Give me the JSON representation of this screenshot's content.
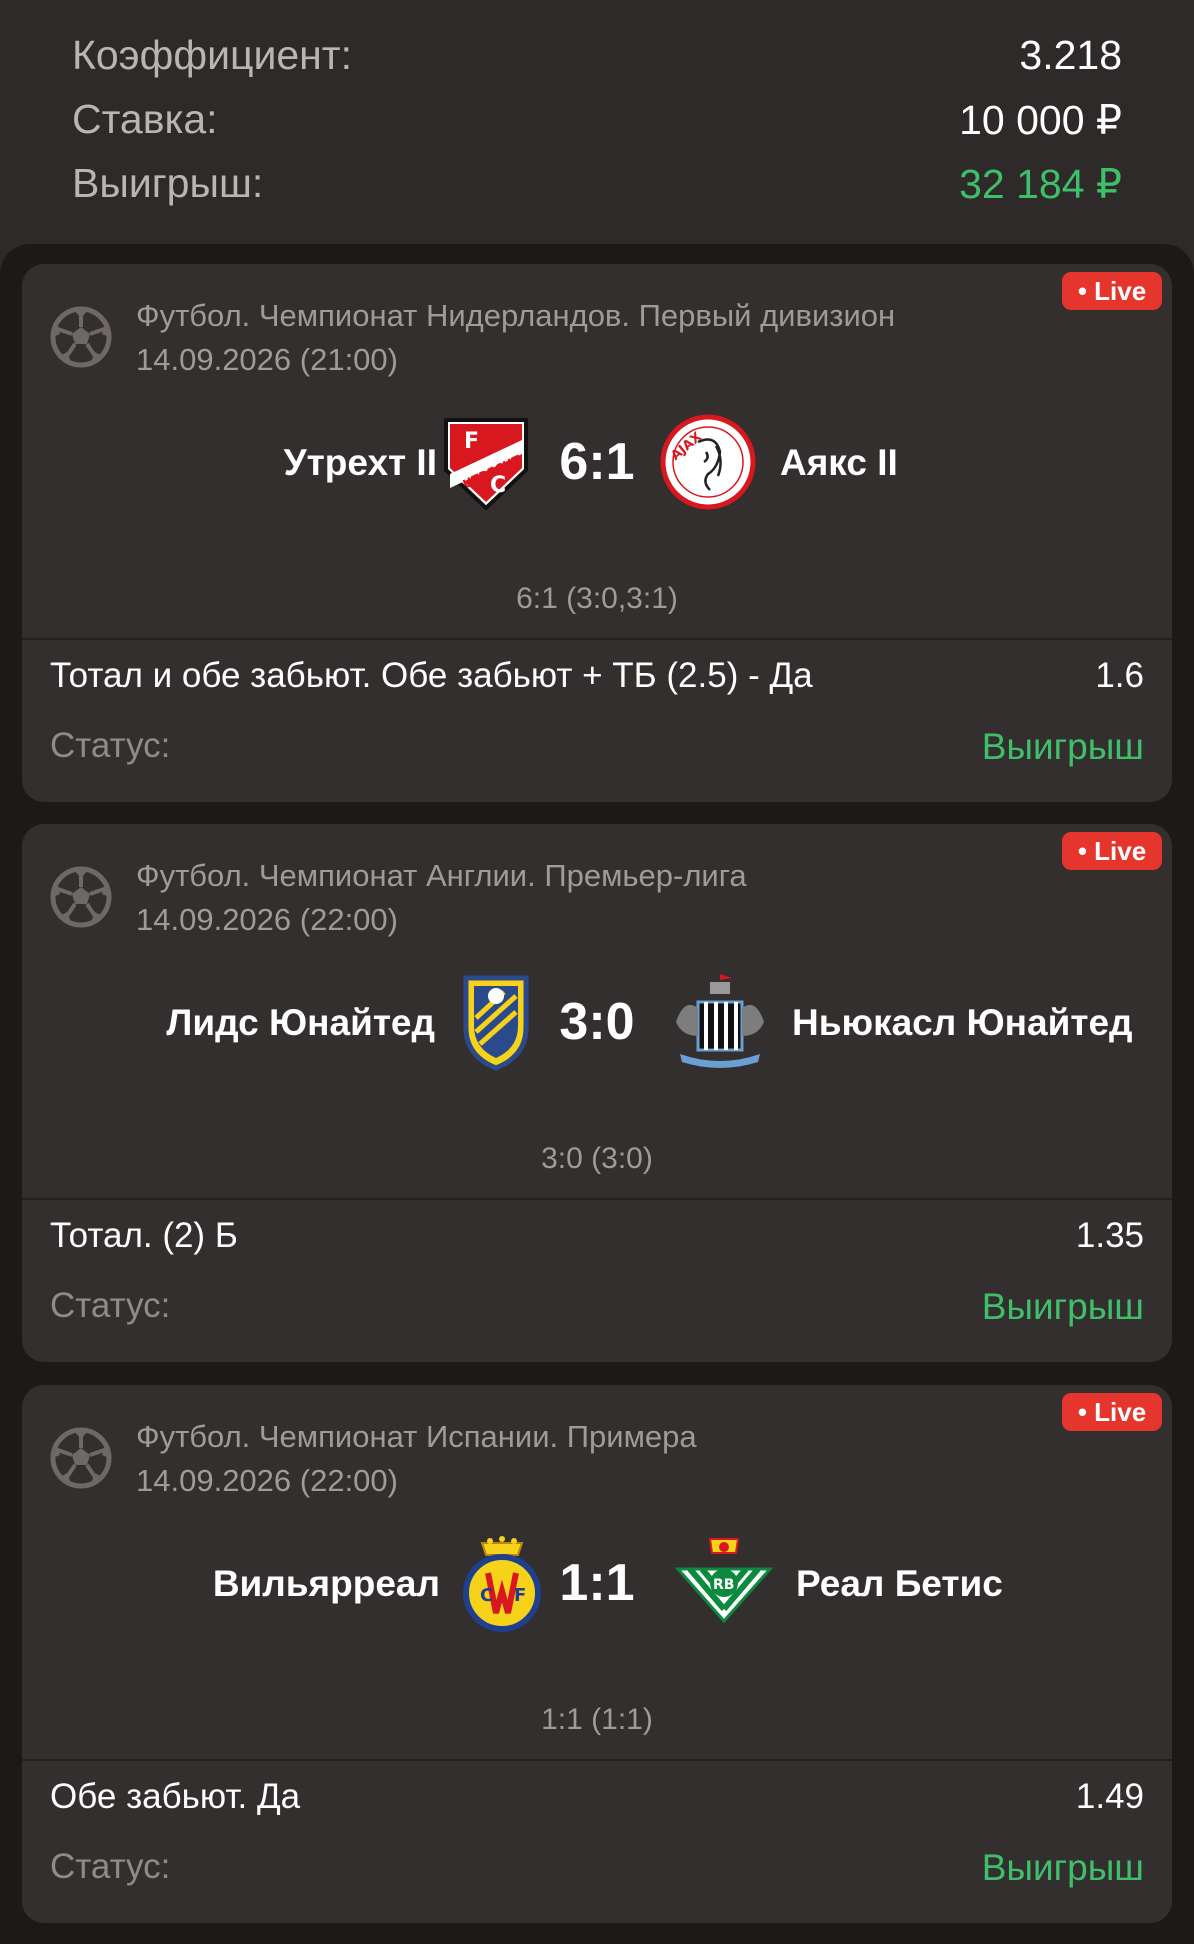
{
  "summary": {
    "coef_label": "Коэффициент:",
    "coef_value": "3.218",
    "stake_label": "Ставка:",
    "stake_value": "10 000 ₽",
    "win_label": "Выигрыш:",
    "win_value": "32 184 ₽"
  },
  "colors": {
    "win_green": "#3fbf6a",
    "live_red": "#e5352d",
    "card_bg": "#332f2e",
    "page_bg": "#1c1918"
  },
  "bets": [
    {
      "live": "• Live",
      "sport_icon": "soccer-ball-icon",
      "league": "Футбол. Чемпионат Нидерландов. Первый дивизион",
      "date": "14.09.2026 (21:00)",
      "home": "Утрехт II",
      "home_crest": "utrecht-crest-icon",
      "score": "6:1",
      "away": "Аякс II",
      "away_crest": "ajax-crest-icon",
      "detail": "6:1 (3:0,3:1)",
      "market": "Тотал и обе забьют. Обе забьют + ТБ (2.5) - Да",
      "odds": "1.6",
      "status_label": "Статус:",
      "status": "Выигрыш"
    },
    {
      "live": "• Live",
      "sport_icon": "soccer-ball-icon",
      "league": "Футбол. Чемпионат Англии. Премьер-лига",
      "date": "14.09.2026 (22:00)",
      "home": "Лидс Юнайтед",
      "home_crest": "leeds-crest-icon",
      "score": "3:0",
      "away": "Ньюкасл Юнайтед",
      "away_crest": "newcastle-crest-icon",
      "detail": "3:0 (3:0)",
      "market": "Тотал. (2) Б",
      "odds": "1.35",
      "status_label": "Статус:",
      "status": "Выигрыш"
    },
    {
      "live": "• Live",
      "sport_icon": "soccer-ball-icon",
      "league": "Футбол. Чемпионат Испании. Примера",
      "date": "14.09.2026 (22:00)",
      "home": "Вильярреал",
      "home_crest": "villarreal-crest-icon",
      "score": "1:1",
      "away": "Реал Бетис",
      "away_crest": "betis-crest-icon",
      "detail": "1:1 (1:1)",
      "market": "Обе забьют. Да",
      "odds": "1.49",
      "status_label": "Статус:",
      "status": "Выигрыш"
    }
  ]
}
